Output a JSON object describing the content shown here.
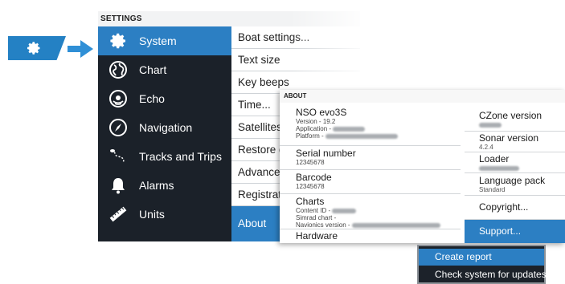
{
  "settings": {
    "header": "SETTINGS",
    "menu": [
      {
        "label": "System",
        "icon": "gear-icon",
        "selected": true
      },
      {
        "label": "Chart",
        "icon": "globe-icon"
      },
      {
        "label": "Echo",
        "icon": "echo-icon"
      },
      {
        "label": "Navigation",
        "icon": "compass-icon"
      },
      {
        "label": "Tracks and Trips",
        "icon": "tracks-icon"
      },
      {
        "label": "Alarms",
        "icon": "bell-icon"
      },
      {
        "label": "Units",
        "icon": "ruler-icon"
      }
    ],
    "submenu": [
      {
        "label": "Boat settings..."
      },
      {
        "label": "Text size"
      },
      {
        "label": "Key beeps"
      },
      {
        "label": "Time..."
      },
      {
        "label": "Satellites..."
      },
      {
        "label": "Restore defaults..."
      },
      {
        "label": "Advanced..."
      },
      {
        "label": "Registration..."
      },
      {
        "label": "About",
        "selected": true
      }
    ]
  },
  "about": {
    "header": "ABOUT",
    "product": {
      "title": "NSO evo3S",
      "version_label": "Version -",
      "version": "19.2",
      "application_label": "Application -",
      "platform_label": "Platform -"
    },
    "serial": {
      "title": "Serial number",
      "value": "12345678"
    },
    "barcode": {
      "title": "Barcode",
      "value": "12345678"
    },
    "charts": {
      "title": "Charts",
      "content_id_label": "Content ID -",
      "simrad_label": "Simrad chart -",
      "navionics_label": "Navionics version -"
    },
    "hardware": {
      "title": "Hardware"
    },
    "right": [
      {
        "title": "CZone version"
      },
      {
        "title": "Sonar version",
        "value": "4.2.4"
      },
      {
        "title": "Loader"
      },
      {
        "title": "Language pack",
        "value": "Standard"
      },
      {
        "title": "Copyright..."
      },
      {
        "title": "Support...",
        "selected": true
      }
    ]
  },
  "support_menu": {
    "items": [
      {
        "label": "Create report",
        "selected": true
      },
      {
        "label": "Check system for updates"
      }
    ]
  },
  "colors": {
    "accent": "#2c7fc3",
    "panel_dark": "#1b2129"
  }
}
